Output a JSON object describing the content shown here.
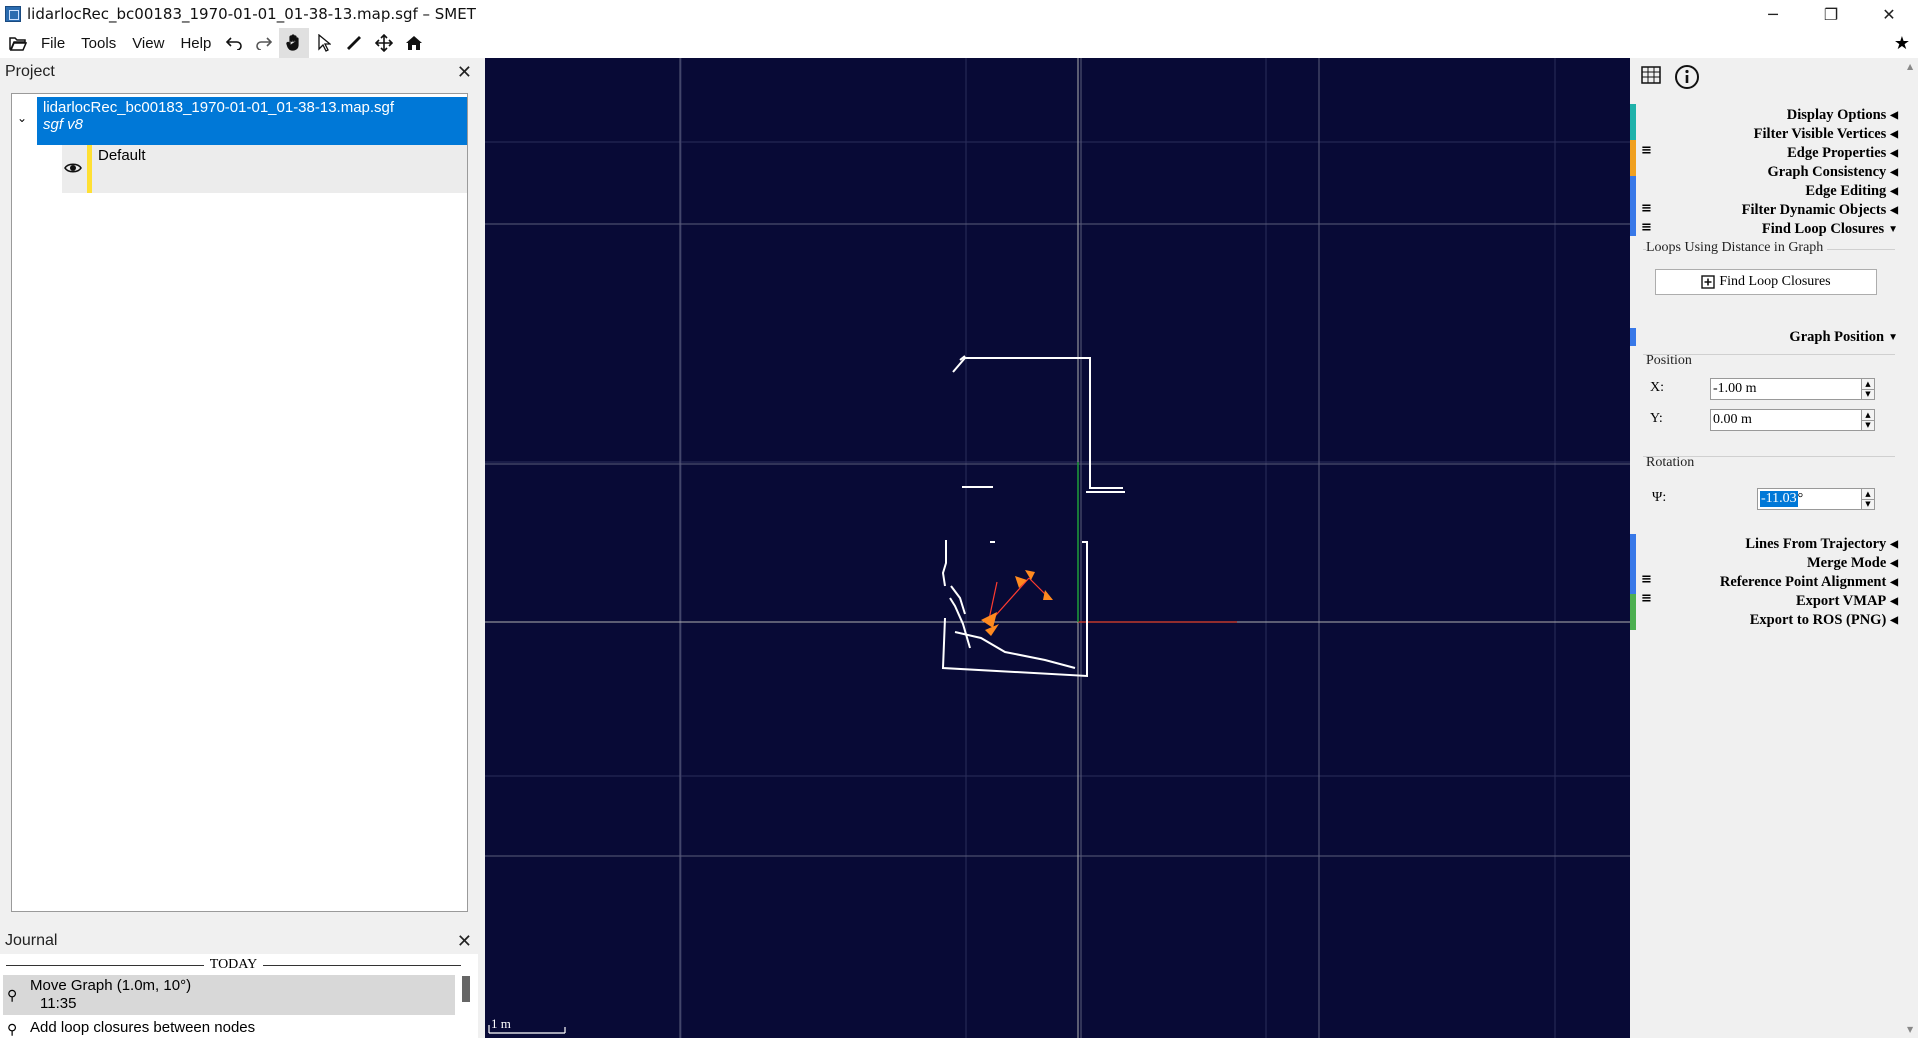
{
  "window": {
    "title": "lidarlocRec_bc00183_1970-01-01_01-38-13.map.sgf – SMET",
    "controls": {
      "minimize": "─",
      "restore": "❐",
      "close": "✕"
    }
  },
  "menu": {
    "items": [
      "File",
      "Tools",
      "View",
      "Help"
    ],
    "tools": [
      "open-folder-icon",
      "undo-icon",
      "redo-icon",
      "pan-hand-icon",
      "select-pointer-icon",
      "measure-ruler-icon",
      "move-cross-icon",
      "home-icon"
    ]
  },
  "project": {
    "header": "Project",
    "close": "✕",
    "root": {
      "name": "lidarlocRec_bc00183_1970-01-01_01-38-13.map.sgf",
      "format": "sgf v8",
      "expander": "⌄"
    },
    "layer": {
      "name": "Default"
    }
  },
  "journal": {
    "header": "Journal",
    "close": "✕",
    "today": "TODAY",
    "entries": [
      {
        "title": "Move Graph (1.0m, 10°)",
        "time": "11:35"
      },
      {
        "title": "Add loop closures between nodes",
        "time": ""
      }
    ]
  },
  "viewport": {
    "scale_label": "1 m",
    "colors": {
      "background": "#080a36",
      "grid": "#2a2d5a",
      "x_axis": "#c0392b",
      "y_axis": "#1e9e3a",
      "trajectory": "#ff8a1f"
    }
  },
  "panel": {
    "sections_top": [
      "Display Options",
      "Filter Visible Vertices",
      "Edge Properties",
      "Graph Consistency",
      "Edge Editing",
      "Filter Dynamic Objects",
      "Find Loop Closures"
    ],
    "loop_group_title": "Loops Using Distance in Graph",
    "find_loop_button": "Find Loop Closures",
    "graph_position": "Graph Position",
    "position_group": "Position",
    "x_label": "X:",
    "x_value": "-1.00 m",
    "y_label": "Y:",
    "y_value": "0.00 m",
    "rotation_group": "Rotation",
    "psi_label": "Ψ:",
    "psi_value": "-11.03",
    "psi_unit": "°",
    "sections_bottom": [
      "Lines From Trajectory",
      "Merge Mode",
      "Reference Point Alignment",
      "Export VMAP",
      "Export to ROS (PNG)"
    ],
    "strip_colors": {
      "teal": "#20b2aa",
      "orange": "#f0a020",
      "blue": "#3878e8",
      "green": "#4caf50"
    }
  }
}
